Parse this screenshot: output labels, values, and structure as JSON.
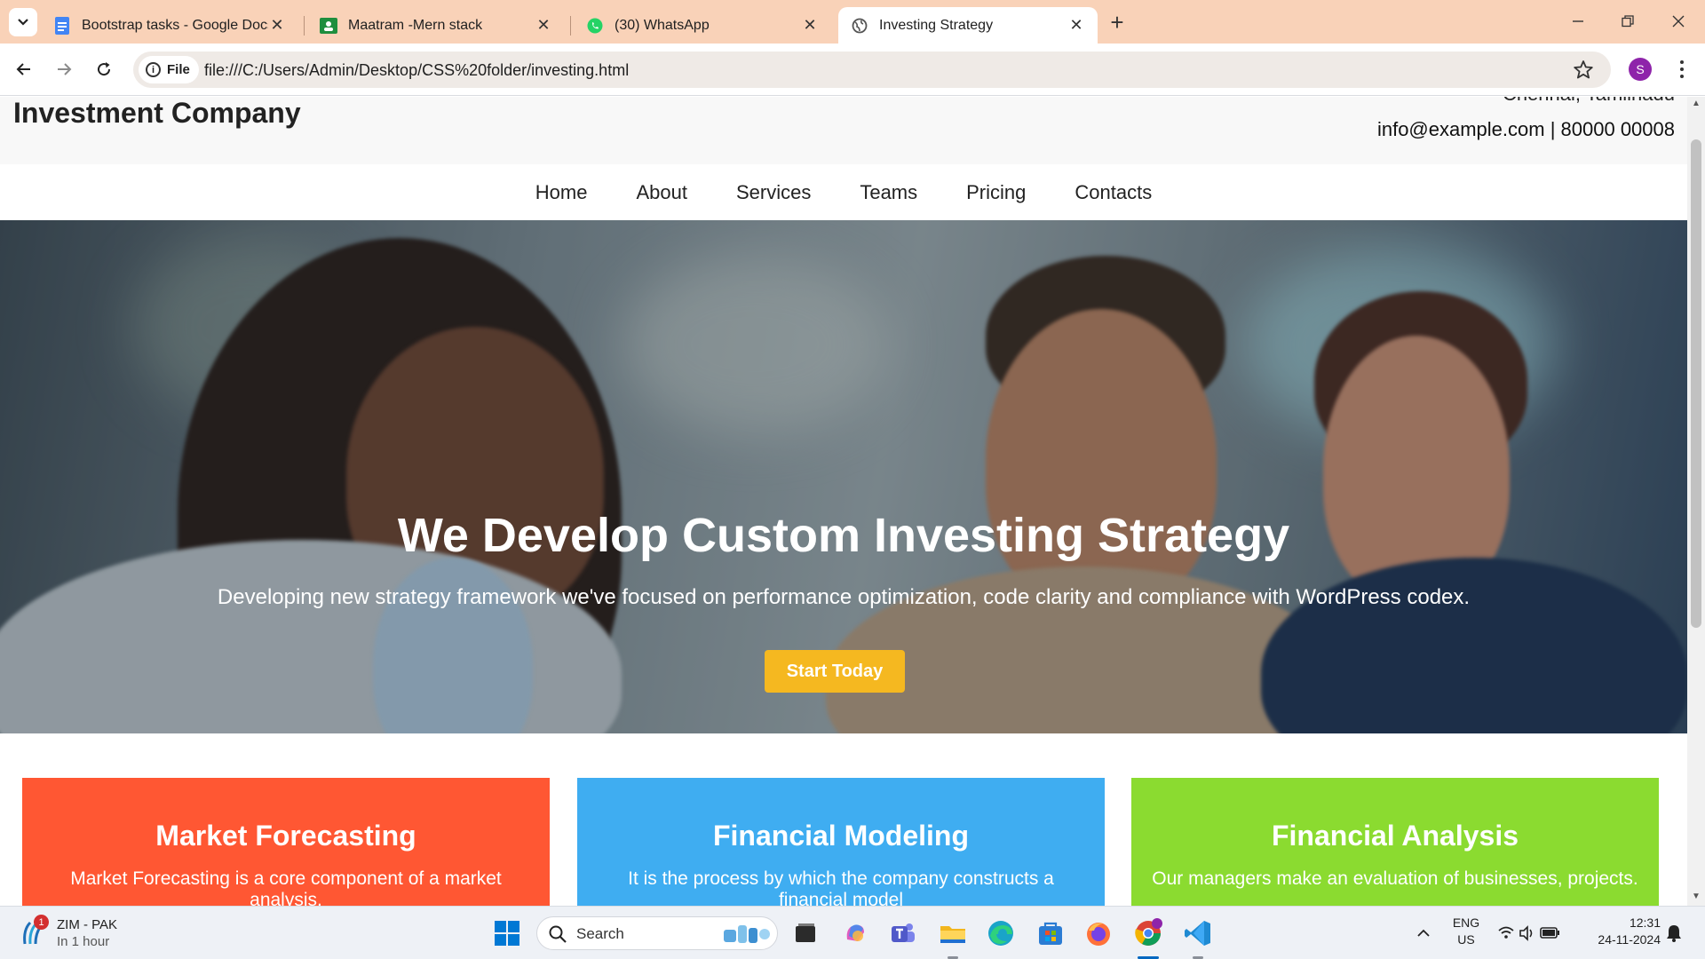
{
  "browser": {
    "tabs": [
      {
        "title": "Bootstrap tasks - Google Docs",
        "active": false
      },
      {
        "title": "Maatram -Mern stack",
        "active": false
      },
      {
        "title": "(30) WhatsApp",
        "active": false
      },
      {
        "title": "Investing Strategy",
        "active": true
      }
    ],
    "file_chip": "File",
    "url": "file:///C:/Users/Admin/Desktop/CSS%20folder/investing.html",
    "profile_initial": "S"
  },
  "page": {
    "brand": "Investment Company",
    "header_top_cut": "Chennai, Tamilnadu",
    "contact": "info@example.com | 80000 00008",
    "nav": [
      "Home",
      "About",
      "Services",
      "Teams",
      "Pricing",
      "Contacts"
    ],
    "hero": {
      "title": "We Develop Custom Investing Strategy",
      "subtitle": "Developing new strategy framework we've focused on performance optimization, code clarity and compliance with WordPress codex.",
      "cta": "Start Today"
    },
    "cards": [
      {
        "title": "Market Forecasting",
        "text": "Market Forecasting is a core component of a market analysis.",
        "color": "#ff5733"
      },
      {
        "title": "Financial Modeling",
        "text": "It is the process by which the company constructs a financial model",
        "color": "#3fadf1"
      },
      {
        "title": "Financial Analysis",
        "text": "Our managers make an evaluation of businesses, projects.",
        "color": "#8bdb30"
      }
    ]
  },
  "taskbar": {
    "weather_title": "ZIM - PAK",
    "weather_sub": "In 1 hour",
    "weather_badge": "1",
    "search_placeholder": "Search",
    "lang_line1": "ENG",
    "lang_line2": "US",
    "time": "12:31",
    "date": "24-11-2024"
  }
}
